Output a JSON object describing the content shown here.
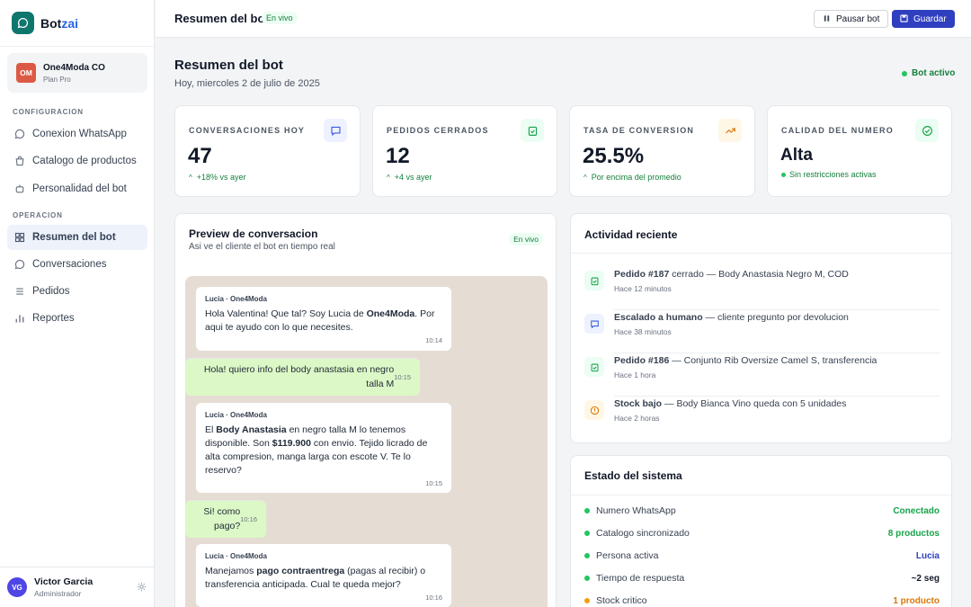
{
  "brand": {
    "name_main": "Bot",
    "name_accent": "zai"
  },
  "account": {
    "initials": "OM",
    "name": "One4Moda CO",
    "plan": "Plan Pro"
  },
  "sidebar": {
    "section1": "CONFIGURACION",
    "section2": "OPERACION",
    "items": [
      {
        "label": "Conexion WhatsApp",
        "icon": "chat-bubble-icon"
      },
      {
        "label": "Catalogo de productos",
        "icon": "catalog-icon"
      },
      {
        "label": "Personalidad del bot",
        "icon": "bot-icon"
      },
      {
        "label": "Resumen del bot",
        "icon": "grid-icon",
        "active": true
      },
      {
        "label": "Conversaciones",
        "icon": "chat-bubble-icon"
      },
      {
        "label": "Pedidos",
        "icon": "list-icon"
      },
      {
        "label": "Reportes",
        "icon": "bar-chart-icon"
      }
    ]
  },
  "user": {
    "initials": "VG",
    "name": "Victor Garcia",
    "role": "Administrador"
  },
  "topbar": {
    "title": "Resumen del bot",
    "badge": "En vivo",
    "pause_label": "Pausar bot",
    "save_label": "Guardar"
  },
  "header": {
    "title": "Resumen del bot",
    "subtitle": "Hoy, miercoles 2 de julio de 2025",
    "status": "Bot activo"
  },
  "stats": [
    {
      "label": "CONVERSACIONES HOY",
      "value": "47",
      "delta": "+18% vs ayer",
      "icon": "chat-icon",
      "color": "#3b5bdb",
      "bg": "#eef2ff"
    },
    {
      "label": "PEDIDOS CERRADOS",
      "value": "12",
      "delta": "+4 vs ayer",
      "icon": "order-icon",
      "color": "#16a34a",
      "bg": "#ecfdf3"
    },
    {
      "label": "TASA DE CONVERSION",
      "value": "25.5%",
      "delta": "Por encima del promedio",
      "icon": "trend-up-icon",
      "color": "#d97706",
      "bg": "#fff7e6"
    },
    {
      "label": "CALIDAD DEL NUMERO",
      "value": "Alta",
      "delta": "Sin restricciones activas",
      "icon": "check-circle-icon",
      "color": "#16a34a",
      "bg": "#ecfdf3"
    }
  ],
  "preview": {
    "title": "Preview de conversacion",
    "subtitle": "Asi ve el cliente el bot en tiempo real",
    "badge": "En vivo",
    "sender": "Lucia · One4Moda",
    "messages": [
      {
        "from": "bot",
        "t1": "Hola Valentina! Que tal? Soy Lucia de ",
        "b1": "One4Moda",
        "t2": ". Por aqui te ayudo con lo que necesites.",
        "time": "10:14"
      },
      {
        "from": "user",
        "text": "Hola! quiero info del body anastasia en negro talla M",
        "time": "10:15"
      },
      {
        "from": "bot",
        "t1": "El ",
        "b1": "Body Anastasia",
        "t2": " en negro talla M lo tenemos disponible. Son ",
        "b2": "$119.900",
        "t3": " con envio. Tejido licrado de alta compresion, manga larga con escote V. Te lo reservo?",
        "time": "10:15"
      },
      {
        "from": "user",
        "text": "Si! como pago?",
        "time": "10:16"
      },
      {
        "from": "bot",
        "t1": "Manejamos ",
        "b1": "pago contraentrega",
        "t2": " (pagas al recibir) o transferencia anticipada. Cual te queda mejor?",
        "time": "10:16"
      }
    ]
  },
  "activity": {
    "title": "Actividad reciente",
    "items": [
      {
        "bold": "Pedido #187",
        "text": " cerrado — Body Anastasia Negro M, COD",
        "time": "Hace 12 minutos",
        "icon": "order-icon",
        "color": "#16a34a",
        "bg": "#ecfdf3"
      },
      {
        "bold": "Escalado a humano",
        "text": " — cliente pregunto por devolucion",
        "time": "Hace 38 minutos",
        "icon": "chat-icon",
        "color": "#3b5bdb",
        "bg": "#eef2ff"
      },
      {
        "bold": "Pedido #186",
        "text": " — Conjunto Rib Oversize Camel S, transferencia",
        "time": "Hace 1 hora",
        "icon": "order-icon",
        "color": "#16a34a",
        "bg": "#ecfdf3"
      },
      {
        "bold": "Stock bajo",
        "text": " — Body Bianca Vino queda con 5 unidades",
        "time": "Hace 2 horas",
        "icon": "alert-icon",
        "color": "#d97706",
        "bg": "#fff7e6"
      }
    ]
  },
  "system": {
    "title": "Estado del sistema",
    "rows": [
      {
        "label": "Numero WhatsApp",
        "value": "Conectado",
        "dot": "#22c55e",
        "color": "#16a34a"
      },
      {
        "label": "Catalogo sincronizado",
        "value": "8 productos",
        "dot": "#22c55e",
        "color": "#16a34a"
      },
      {
        "label": "Persona activa",
        "value": "Lucia",
        "dot": "#22c55e",
        "color": "#2f3fbf"
      },
      {
        "label": "Tiempo de respuesta",
        "value": "~2 seg",
        "dot": "#22c55e",
        "color": "#111827"
      },
      {
        "label": "Stock critico",
        "value": "1 producto",
        "dot": "#f59e0b",
        "color": "#d97706"
      }
    ]
  }
}
